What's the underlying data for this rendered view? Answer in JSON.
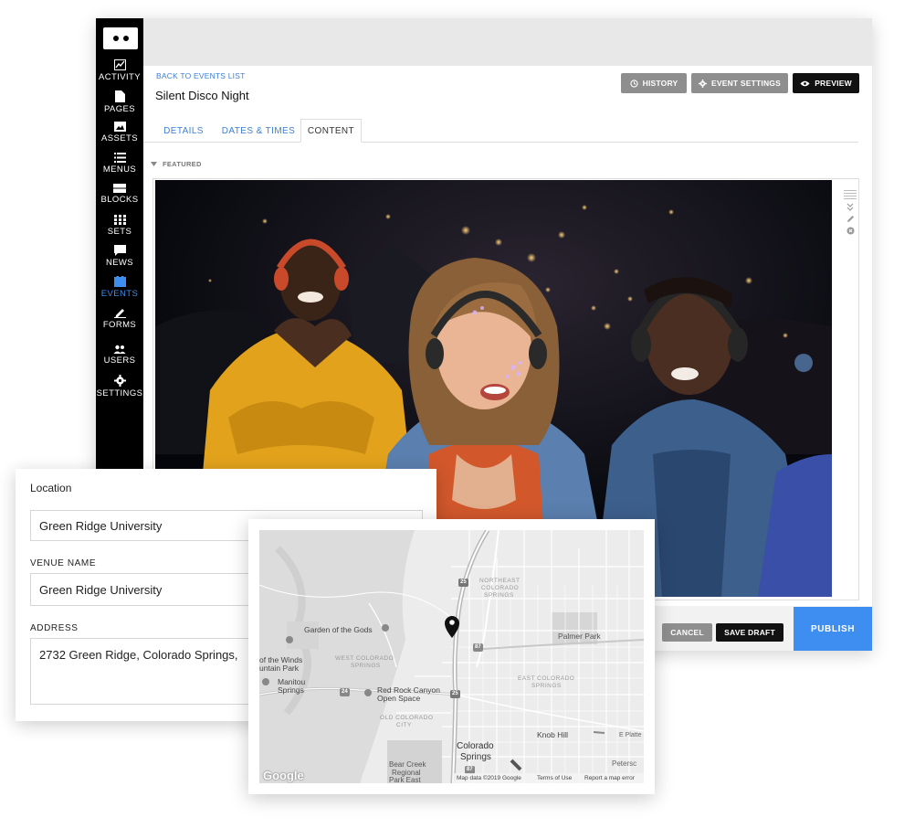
{
  "sidebar": {
    "items": [
      {
        "label": "ACTIVITY",
        "icon": "activity-icon"
      },
      {
        "label": "PAGES",
        "icon": "pages-icon"
      },
      {
        "label": "ASSETS",
        "icon": "assets-icon"
      },
      {
        "label": "MENUS",
        "icon": "menus-icon"
      },
      {
        "label": "BLOCKS",
        "icon": "blocks-icon"
      },
      {
        "label": "SETS",
        "icon": "sets-icon"
      },
      {
        "label": "NEWS",
        "icon": "news-icon"
      },
      {
        "label": "EVENTS",
        "icon": "events-icon",
        "active": true
      },
      {
        "label": "FORMS",
        "icon": "forms-icon"
      },
      {
        "label": "USERS",
        "icon": "users-icon"
      },
      {
        "label": "SETTINGS",
        "icon": "settings-icon"
      }
    ]
  },
  "header": {
    "back_link": "BACK TO EVENTS LIST",
    "title": "Silent Disco Night",
    "history_label": "HISTORY",
    "event_settings_label": "EVENT SETTINGS",
    "preview_label": "PREVIEW"
  },
  "tabs": [
    {
      "label": "DETAILS"
    },
    {
      "label": "DATES & TIMES"
    },
    {
      "label": "CONTENT",
      "active": true
    }
  ],
  "content": {
    "section_label": "FEATURED"
  },
  "footer": {
    "cancel_label": "CANCEL",
    "save_draft_label": "SAVE DRAFT",
    "publish_label": "PUBLISH"
  },
  "location": {
    "title": "Location",
    "location_value": "Green Ridge University",
    "venue_label": "VENUE NAME",
    "venue_value": "Green Ridge University",
    "address_label": "ADDRESS",
    "address_value": "2732 Green Ridge, Colorado Springs,"
  },
  "map": {
    "labels": {
      "northeast": "NORTHEAST",
      "colorado_ne": "COLORADO",
      "springs_ne": "SPRINGS",
      "garden": "Garden of the Gods",
      "palmer": "Palmer Park",
      "of_the_winds": "of the Winds",
      "untain_park": "untain Park",
      "west": "WEST COLORADO",
      "west_springs": "SPRINGS",
      "manitou": "Manitou",
      "manitou_springs": "Springs",
      "red_rock": "Red Rock Canyon",
      "open_space": "Open Space",
      "east": "EAST COLORADO",
      "east_springs": "SPRINGS",
      "old": "OLD COLORADO",
      "old_city": "CITY",
      "knob_hill": "Knob Hill",
      "e_platte": "E Platte",
      "colorado_springs_1": "Colorado",
      "colorado_springs_2": "Springs",
      "petersc": "Petersc",
      "bear_creek_1": "Bear Creek",
      "bear_creek_2": "Regional",
      "bear_creek_3": "Park East",
      "shield_25a": "25",
      "shield_87a": "87",
      "shield_24": "24",
      "shield_25b": "25",
      "shield_87b": "87"
    },
    "google_logo": "Google",
    "map_data": "Map data ©2019 Google",
    "terms": "Terms of Use",
    "report": "Report a map error"
  },
  "colors": {
    "accent": "#3d8ef0",
    "link": "#3d7fd6",
    "sidebar": "#000000",
    "button_grey": "#8e8e8e",
    "button_dark": "#111111"
  }
}
